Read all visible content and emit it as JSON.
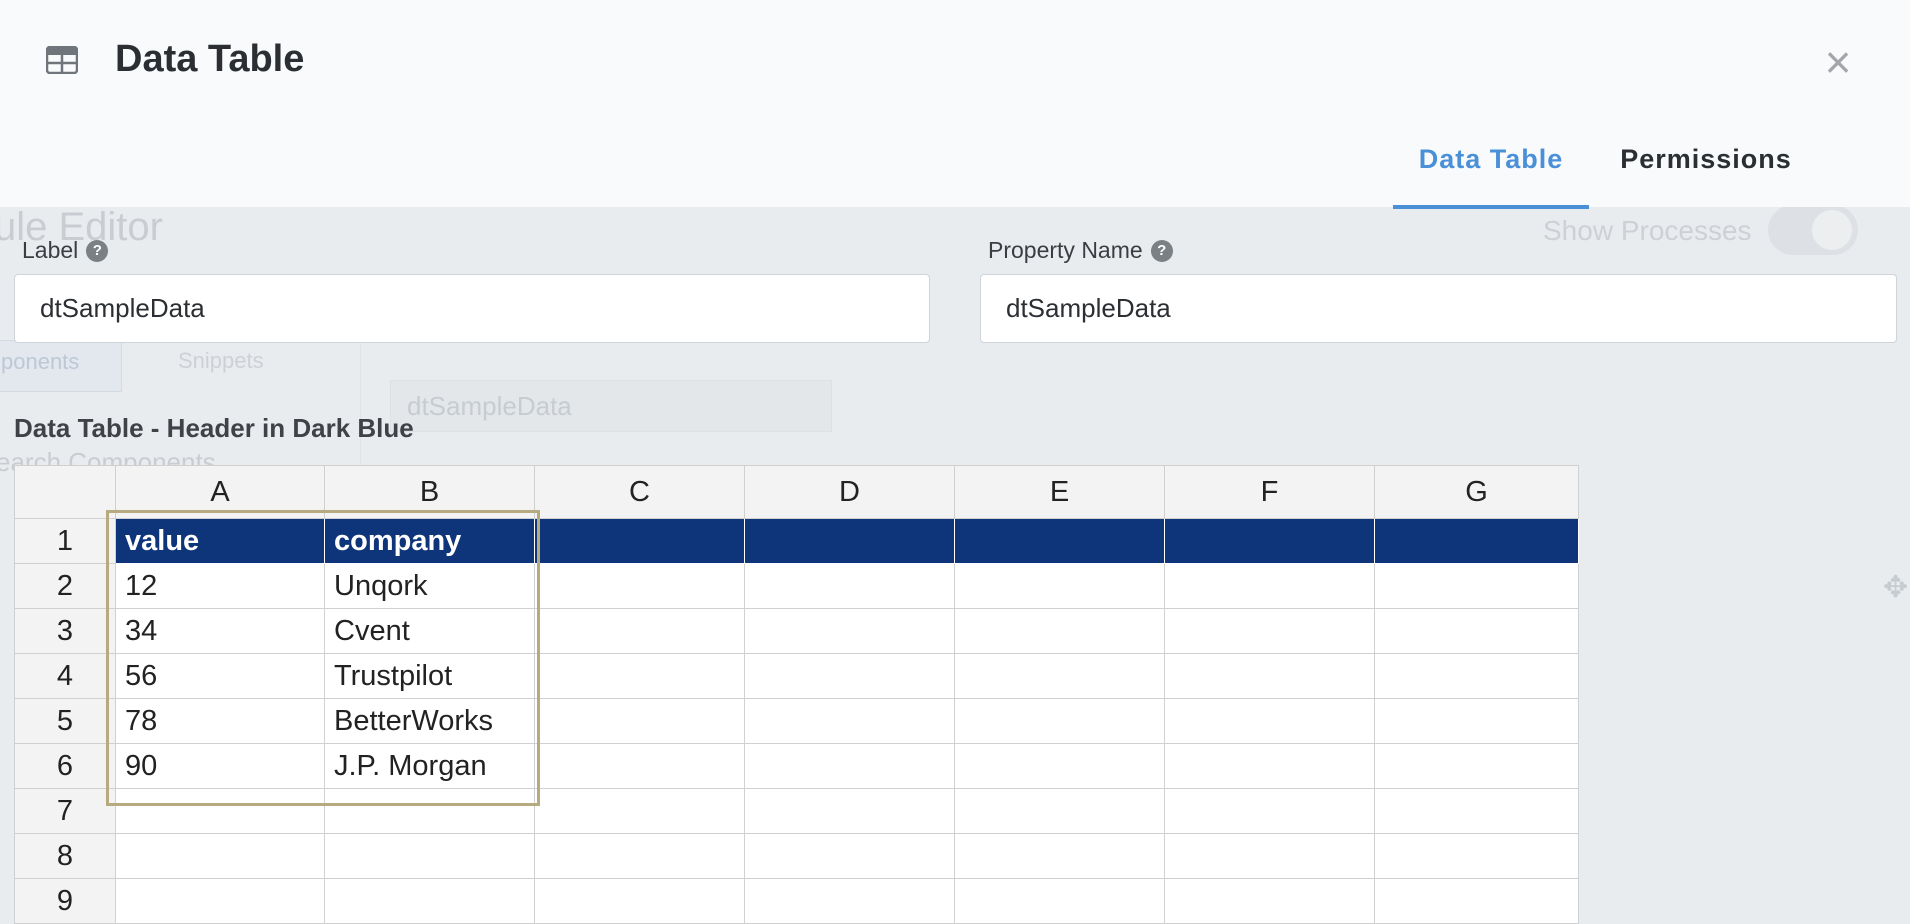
{
  "background": {
    "title": "ule Editor",
    "show_processes": "Show Processes",
    "tab_components": "ponents",
    "tab_snippets": "Snippets",
    "search": "earch Components",
    "field_value": "dtSampleData"
  },
  "modal": {
    "title": "Data Table",
    "icon": "table-icon",
    "close_icon": "close-icon",
    "close_glyph": "×",
    "tabs": [
      {
        "label": "Data Table",
        "active": true
      },
      {
        "label": "Permissions",
        "active": false
      }
    ],
    "label_field": {
      "label": "Label",
      "value": "dtSampleData"
    },
    "property_field": {
      "label": "Property Name",
      "value": "dtSampleData"
    },
    "help_glyph": "?",
    "section_label": "Data Table - Header in Dark Blue"
  },
  "sheet": {
    "columns": [
      "A",
      "B",
      "C",
      "D",
      "E",
      "F",
      "G"
    ],
    "row_numbers": [
      "1",
      "2",
      "3",
      "4",
      "5",
      "6",
      "7",
      "8",
      "9"
    ],
    "rows": [
      [
        "value",
        "company",
        "",
        "",
        "",
        "",
        ""
      ],
      [
        "12",
        "Unqork",
        "",
        "",
        "",
        "",
        ""
      ],
      [
        "34",
        "Cvent",
        "",
        "",
        "",
        "",
        ""
      ],
      [
        "56",
        "Trustpilot",
        "",
        "",
        "",
        "",
        ""
      ],
      [
        "78",
        "BetterWorks",
        "",
        "",
        "",
        "",
        ""
      ],
      [
        "90",
        "J.P. Morgan",
        "",
        "",
        "",
        "",
        ""
      ],
      [
        "",
        "",
        "",
        "",
        "",
        "",
        ""
      ],
      [
        "",
        "",
        "",
        "",
        "",
        "",
        ""
      ],
      [
        "",
        "",
        "",
        "",
        "",
        "",
        ""
      ]
    ],
    "header_color": "#0e347a",
    "selection_color": "#b5aa80"
  }
}
